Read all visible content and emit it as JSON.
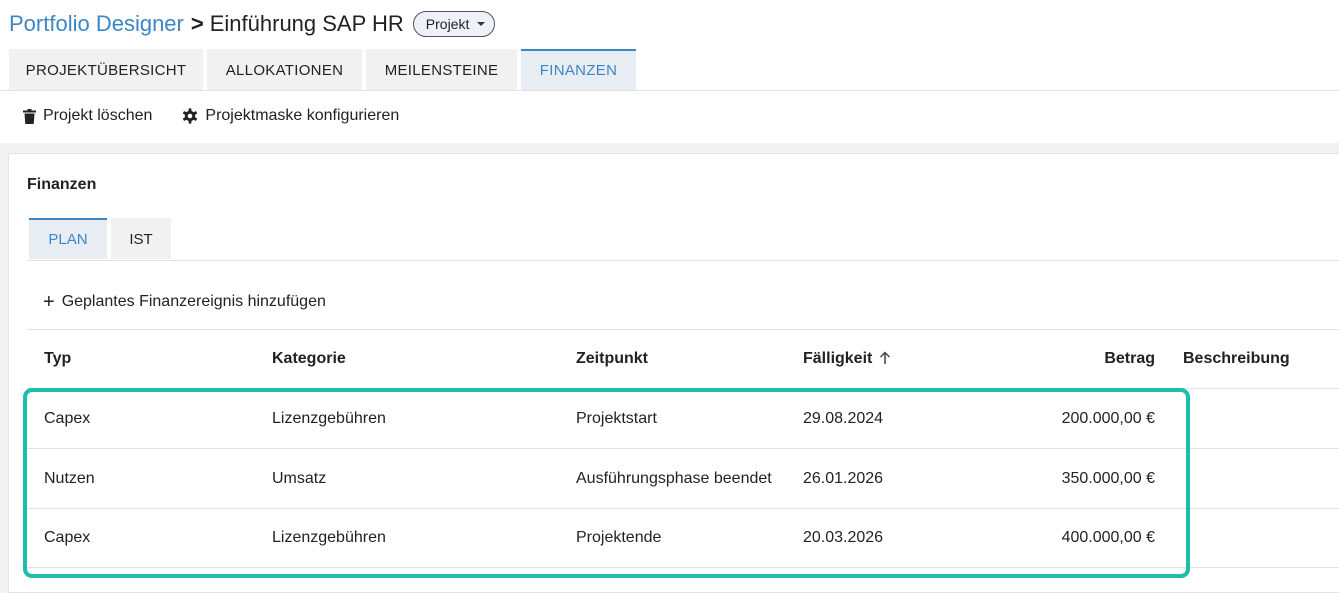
{
  "breadcrumb": {
    "root": "Portfolio Designer",
    "separator": ">",
    "current": "Einführung SAP HR",
    "type_badge": "Projekt"
  },
  "main_tabs": [
    {
      "label": "PROJEKTÜBERSICHT",
      "active": false
    },
    {
      "label": "ALLOKATIONEN",
      "active": false
    },
    {
      "label": "MEILENSTEINE",
      "active": false
    },
    {
      "label": "FINANZEN",
      "active": true
    }
  ],
  "actions": {
    "delete_label": "Projekt löschen",
    "configure_label": "Projektmaske konfigurieren"
  },
  "finance": {
    "title": "Finanzen",
    "sub_tabs": [
      {
        "label": "PLAN",
        "active": true
      },
      {
        "label": "IST",
        "active": false
      }
    ],
    "add_label": "Geplantes Finanzereignis hinzufügen",
    "columns": {
      "type": "Typ",
      "category": "Kategorie",
      "timepoint": "Zeitpunkt",
      "due": "Fälligkeit",
      "amount": "Betrag",
      "description": "Beschreibung"
    },
    "sort_column": "due",
    "sort_direction": "ascending",
    "rows": [
      {
        "type": "Capex",
        "category": "Lizenzgebühren",
        "timepoint": "Projektstart",
        "due": "29.08.2024",
        "amount": "200.000,00 €",
        "description": ""
      },
      {
        "type": "Nutzen",
        "category": "Umsatz",
        "timepoint": "Ausführungsphase beendet",
        "due": "26.01.2026",
        "amount": "350.000,00 €",
        "description": ""
      },
      {
        "type": "Capex",
        "category": "Lizenzgebühren",
        "timepoint": "Projektende",
        "due": "20.03.2026",
        "amount": "400.000,00 €",
        "description": ""
      }
    ]
  },
  "colors": {
    "accent": "#3d86c6",
    "highlight": "#1dbdab",
    "active_tab_bg": "#e8edf3",
    "tab_bg": "#f1f1f1"
  }
}
